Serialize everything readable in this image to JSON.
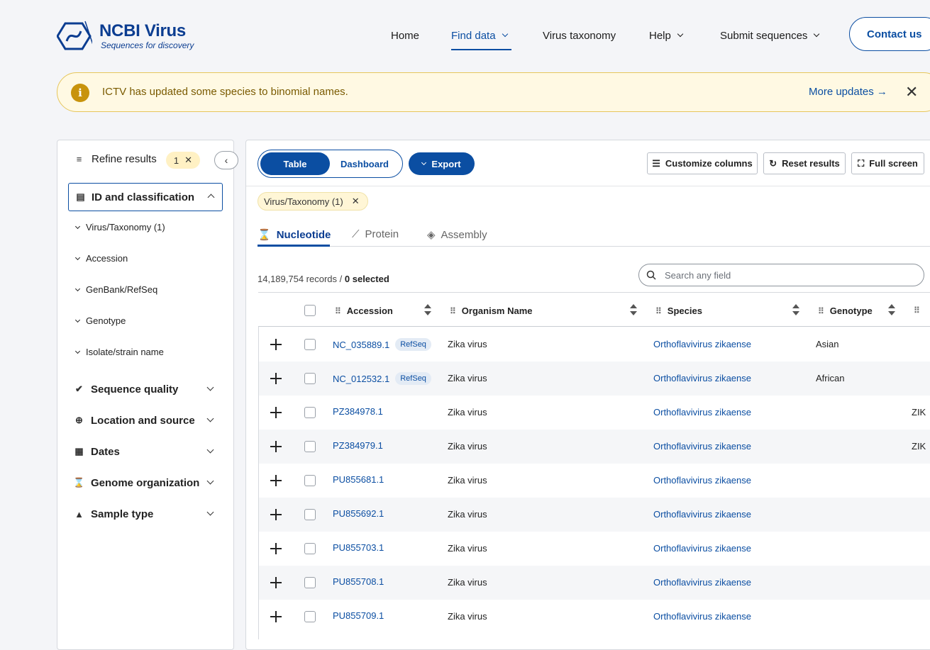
{
  "header": {
    "logo_title": "NCBI Virus",
    "logo_subtitle": "Sequences for discovery",
    "nav": {
      "home": "Home",
      "find_data": "Find data",
      "virus_taxonomy": "Virus taxonomy",
      "help": "Help",
      "submit_sequences": "Submit sequences"
    },
    "contact": "Contact us"
  },
  "banner": {
    "message": "ICTV has updated some species to binomial names.",
    "link": "More updates"
  },
  "sidebar": {
    "refine_label": "Refine results",
    "refine_count": "1",
    "active_section": "ID and classification",
    "sub_items": [
      "Virus/Taxonomy (1)",
      "Accession",
      "GenBank/RefSeq",
      "Genotype",
      "Isolate/strain name"
    ],
    "sections": [
      "Sequence quality",
      "Location and source",
      "Dates",
      "Genome organization",
      "Sample type"
    ]
  },
  "toolbar": {
    "view_table": "Table",
    "view_dashboard": "Dashboard",
    "export": "Export",
    "customize": "Customize columns",
    "reset": "Reset results",
    "fullscreen": "Full screen"
  },
  "filter_chip": "Virus/Taxonomy (1)",
  "tabs": [
    "Nucleotide",
    "Protein",
    "Assembly"
  ],
  "records": {
    "total": "14,189,754 records /",
    "selected_count": "0",
    "selected_label": "selected"
  },
  "search": {
    "placeholder": "Search any field"
  },
  "table": {
    "columns": [
      "Accession",
      "Organism Name",
      "Species",
      "Genotype"
    ],
    "rows": [
      {
        "accession": "NC_035889.1",
        "badge": "RefSeq",
        "organism": "Zika virus",
        "species": "Orthoflavivirus zikaense",
        "genotype": "Asian",
        "extra": ""
      },
      {
        "accession": "NC_012532.1",
        "badge": "RefSeq",
        "organism": "Zika virus",
        "species": "Orthoflavivirus zikaense",
        "genotype": "African",
        "extra": ""
      },
      {
        "accession": "PZ384978.1",
        "badge": "",
        "organism": "Zika virus",
        "species": "Orthoflavivirus zikaense",
        "genotype": "",
        "extra": "ZIK"
      },
      {
        "accession": "PZ384979.1",
        "badge": "",
        "organism": "Zika virus",
        "species": "Orthoflavivirus zikaense",
        "genotype": "",
        "extra": "ZIK"
      },
      {
        "accession": "PU855681.1",
        "badge": "",
        "organism": "Zika virus",
        "species": "Orthoflavivirus zikaense",
        "genotype": "",
        "extra": ""
      },
      {
        "accession": "PU855692.1",
        "badge": "",
        "organism": "Zika virus",
        "species": "Orthoflavivirus zikaense",
        "genotype": "",
        "extra": ""
      },
      {
        "accession": "PU855703.1",
        "badge": "",
        "organism": "Zika virus",
        "species": "Orthoflavivirus zikaense",
        "genotype": "",
        "extra": ""
      },
      {
        "accession": "PU855708.1",
        "badge": "",
        "organism": "Zika virus",
        "species": "Orthoflavivirus zikaense",
        "genotype": "",
        "extra": ""
      },
      {
        "accession": "PU855709.1",
        "badge": "",
        "organism": "Zika virus",
        "species": "Orthoflavivirus zikaense",
        "genotype": "",
        "extra": ""
      }
    ]
  },
  "colors": {
    "primary": "#0b4ea2",
    "banner_bg": "#fff9e3",
    "banner_icon": "#c8930c"
  }
}
